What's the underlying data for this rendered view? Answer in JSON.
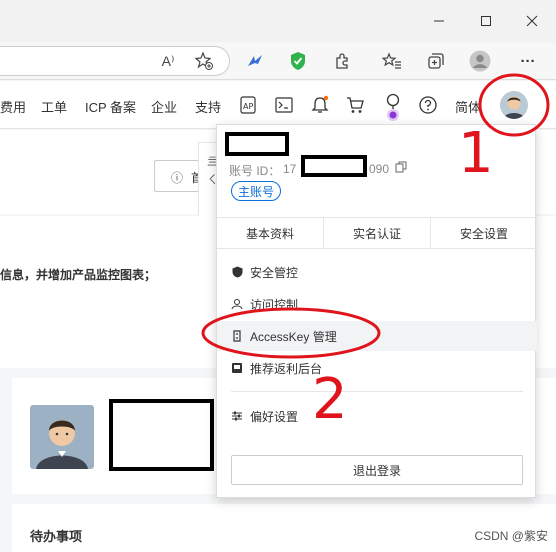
{
  "window": {
    "min_icon": "minimize-icon",
    "max_icon": "maximize-icon",
    "close_icon": "close-icon"
  },
  "toolbar": {
    "icons": [
      "read-aloud-icon",
      "favorite-add-icon",
      "extension-bird-icon",
      "shield-extension-icon",
      "extensions-icon",
      "favorites-icon",
      "collections-icon",
      "profile-icon",
      "more-icon"
    ],
    "read_aloud_label": "A⁾",
    "more_label": "···"
  },
  "nav": {
    "items": [
      "费用",
      "工单",
      "ICP 备案",
      "企业",
      "支持"
    ],
    "lang": "简体",
    "icons": [
      "api-icon",
      "terminal-icon",
      "bell-icon",
      "cart-icon",
      "location-icon",
      "help-icon"
    ]
  },
  "page": {
    "info_text": "信息，并增加产品监控图表；",
    "home_button_icon": "info-icon",
    "home_button_text": "首",
    "todo_title": "待办事项",
    "behind_text_1": "亖",
    "behind_text_2": "ㄑ"
  },
  "account": {
    "id_label": "账号 ID：",
    "id_prefix": "17",
    "id_suffix": "090",
    "badge": "主账号",
    "tabs": [
      "基本资料",
      "实名认证",
      "安全设置"
    ],
    "menu": [
      {
        "label": "安全管控",
        "icon": "shield-icon"
      },
      {
        "label": "访问控制",
        "icon": "access-control-icon"
      },
      {
        "label": "AccessKey 管理",
        "icon": "key-icon"
      },
      {
        "label": "推荐返利后台",
        "icon": "gift-icon"
      },
      {
        "label": "偏好设置",
        "icon": "sliders-icon"
      }
    ],
    "logout": "退出登录"
  },
  "annotations": {
    "num1": "1",
    "num2": "2",
    "color": "#e0141c"
  },
  "watermark": "CSDN @紫安"
}
